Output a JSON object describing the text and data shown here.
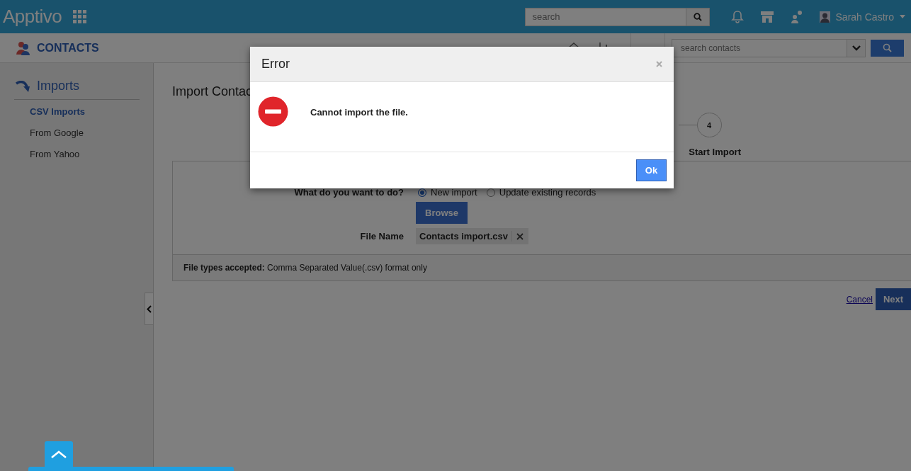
{
  "app_bar": {
    "logo": "Apptivo",
    "search": {
      "placeholder": "search"
    },
    "user": {
      "name": "Sarah Castro"
    }
  },
  "module_bar": {
    "title": "CONTACTS",
    "search": {
      "placeholder": "search contacts"
    }
  },
  "sidebar": {
    "heading": "Imports",
    "items": [
      {
        "label": "CSV Imports",
        "selected": true
      },
      {
        "label": "From Google",
        "selected": false
      },
      {
        "label": "From Yahoo",
        "selected": false
      }
    ]
  },
  "page": {
    "title": "Import Contac",
    "steps": [
      {
        "number": "4",
        "label": "Start Import"
      }
    ],
    "form": {
      "question": "What do you want to do?",
      "options": [
        {
          "label": "New import",
          "selected": true
        },
        {
          "label": "Update existing records",
          "selected": false
        }
      ],
      "browse_button": "Browse",
      "file_name_label": "File Name",
      "file_name": "Contacts import.csv",
      "note": "**File types accepted:** Comma Separated Value(.csv) format only"
    },
    "actions": {
      "cancel": "Cancel",
      "next": "Next"
    }
  },
  "dialog": {
    "title": "Error",
    "message": "Cannot import the file.",
    "button": "Ok"
  }
}
